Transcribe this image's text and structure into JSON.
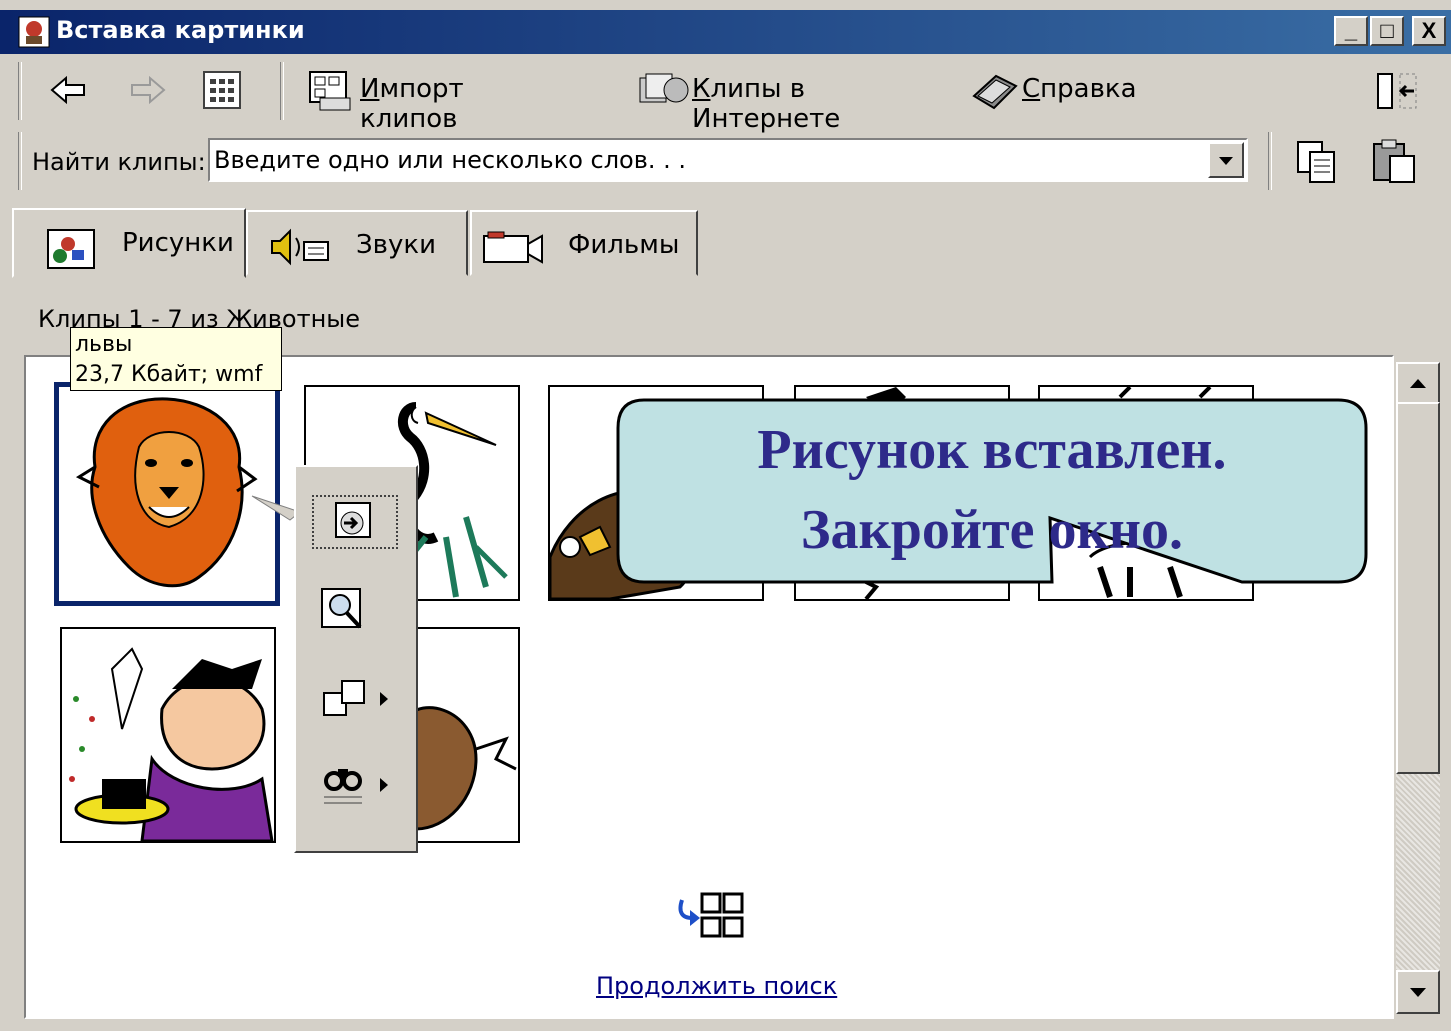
{
  "window": {
    "title": "Вставка картинки",
    "minimize": "_",
    "maximize": "□",
    "close": "X"
  },
  "toolbar": {
    "import_label_u": "И",
    "import_label": "мпорт клипов",
    "online_label_u": "К",
    "online_label": "липы в Интернете",
    "help_label_u": "С",
    "help_label": "правка"
  },
  "search": {
    "label": "Найти клипы:",
    "value": "Введите одно или несколько слов. . ."
  },
  "tabs": [
    {
      "label": "Рисунки",
      "active": true
    },
    {
      "label": "Звуки",
      "active": false
    },
    {
      "label": "Фильмы",
      "active": false
    }
  ],
  "status": "Клипы 1 - 7 из Животные",
  "tooltip": {
    "name": "львы",
    "info": "23,7 Кбайт; wmf"
  },
  "callout": {
    "line1": "Рисунок вставлен.",
    "line2": "Закройте окно."
  },
  "more_link": "Продолжить поиск",
  "colors": {
    "titlebar": "#0a246a",
    "callout_bg": "#bfe1e3",
    "callout_text": "#2e2a8a",
    "link": "#000080"
  }
}
